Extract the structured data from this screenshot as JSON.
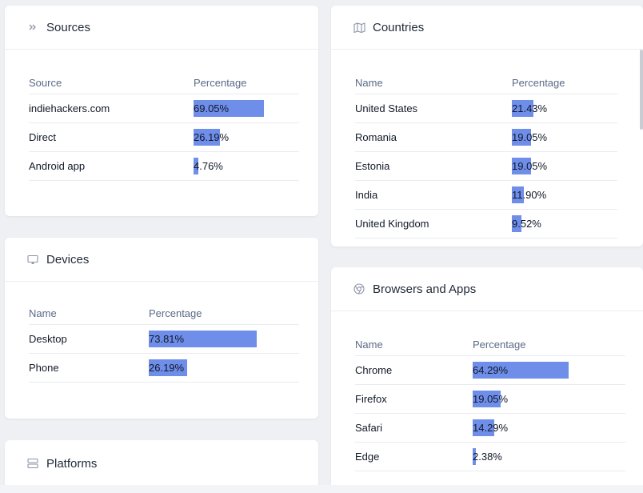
{
  "colors": {
    "bar": "#6e8eea",
    "header_text": "#5b6a87",
    "background": "#eef0f4"
  },
  "sources": {
    "title": "Sources",
    "icon": "chevrons-right-icon",
    "col_name": "Source",
    "col_pct": "Percentage",
    "rows": [
      {
        "name": "indiehackers.com",
        "pct": "69.05%",
        "value": 69.05
      },
      {
        "name": "Direct",
        "pct": "26.19%",
        "value": 26.19
      },
      {
        "name": "Android app",
        "pct": "4.76%",
        "value": 4.76
      }
    ]
  },
  "countries": {
    "title": "Countries",
    "icon": "map-icon",
    "col_name": "Name",
    "col_pct": "Percentage",
    "rows": [
      {
        "name": "United States",
        "pct": "21.43%",
        "value": 21.43
      },
      {
        "name": "Romania",
        "pct": "19.05%",
        "value": 19.05
      },
      {
        "name": "Estonia",
        "pct": "19.05%",
        "value": 19.05
      },
      {
        "name": "India",
        "pct": "11.90%",
        "value": 11.9
      },
      {
        "name": "United Kingdom",
        "pct": "9.52%",
        "value": 9.52
      }
    ]
  },
  "devices": {
    "title": "Devices",
    "icon": "monitor-icon",
    "col_name": "Name",
    "col_pct": "Percentage",
    "rows": [
      {
        "name": "Desktop",
        "pct": "73.81%",
        "value": 73.81
      },
      {
        "name": "Phone",
        "pct": "26.19%",
        "value": 26.19
      }
    ]
  },
  "browsers": {
    "title": "Browsers and Apps",
    "icon": "chrome-icon",
    "col_name": "Name",
    "col_pct": "Percentage",
    "rows": [
      {
        "name": "Chrome",
        "pct": "64.29%",
        "value": 64.29
      },
      {
        "name": "Firefox",
        "pct": "19.05%",
        "value": 19.05
      },
      {
        "name": "Safari",
        "pct": "14.29%",
        "value": 14.29
      },
      {
        "name": "Edge",
        "pct": "2.38%",
        "value": 2.38
      }
    ]
  },
  "platforms": {
    "title": "Platforms",
    "icon": "server-icon"
  }
}
